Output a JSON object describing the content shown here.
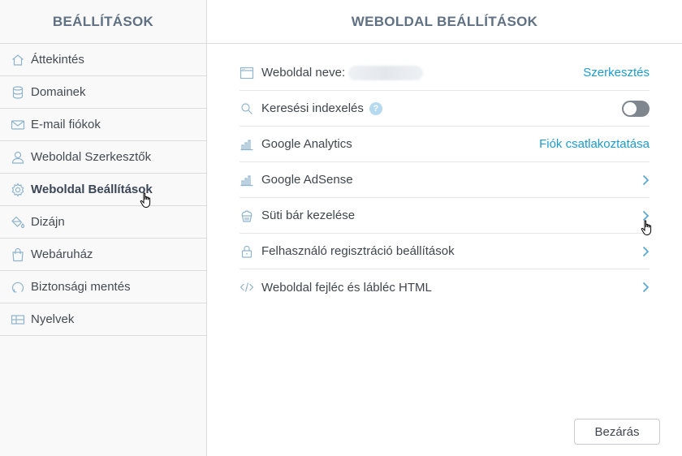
{
  "sidebar": {
    "title": "BEÁLLÍTÁSOK",
    "items": [
      {
        "label": "Áttekintés",
        "icon": "home-icon"
      },
      {
        "label": "Domainek",
        "icon": "database-icon"
      },
      {
        "label": "E-mail fiókok",
        "icon": "envelope-icon"
      },
      {
        "label": "Weboldal Szerkesztők",
        "icon": "user-icon"
      },
      {
        "label": "Weboldal Beállítások",
        "icon": "gear-icon",
        "active": true
      },
      {
        "label": "Dizájn",
        "icon": "paint-bucket-icon"
      },
      {
        "label": "Webáruház",
        "icon": "shopping-bag-icon"
      },
      {
        "label": "Biztonsági mentés",
        "icon": "backup-icon"
      },
      {
        "label": "Nyelvek",
        "icon": "language-icon"
      }
    ]
  },
  "main": {
    "title": "WEBOLDAL BEÁLLÍTÁSOK",
    "rows": [
      {
        "label": "Weboldal neve:",
        "icon": "browser-window-icon",
        "action": "Szerkesztés"
      },
      {
        "label": "Keresési indexelés",
        "icon": "magnifier-icon",
        "help": "?",
        "toggle_on": false
      },
      {
        "label": "Google Analytics",
        "icon": "bar-chart-icon",
        "action": "Fiók csatlakoztatása"
      },
      {
        "label": "Google AdSense",
        "icon": "bar-chart-icon"
      },
      {
        "label": "Süti bár kezelése",
        "icon": "cupcake-icon"
      },
      {
        "label": "Felhasználó regisztráció beállítások",
        "icon": "lock-icon"
      },
      {
        "label": "Weboldal fejléc és lábléc HTML",
        "icon": "code-icon"
      }
    ],
    "close_label": "Bezárás"
  },
  "colors": {
    "accent": "#1d9bd1",
    "icon": "#8fb4cc",
    "header_text": "#5f7183",
    "border": "#dcdcdc"
  }
}
